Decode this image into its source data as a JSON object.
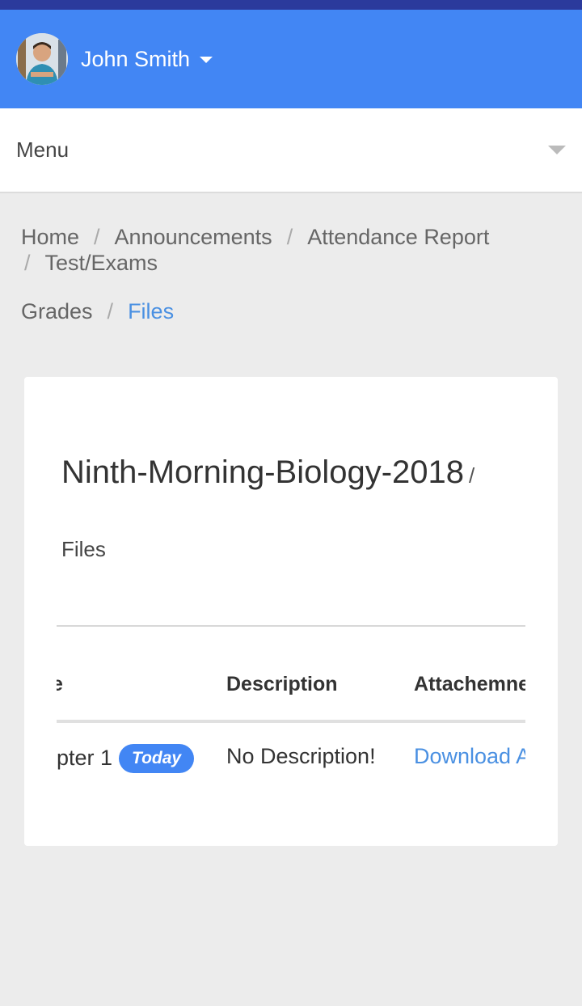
{
  "header": {
    "user_name": "John Smith"
  },
  "menu": {
    "label": "Menu"
  },
  "breadcrumb": {
    "items": [
      "Home",
      "Announcements",
      "Attendance Report",
      "Test/Exams",
      "Grades"
    ],
    "active": "Files",
    "separator": "/"
  },
  "card": {
    "title": "Ninth-Morning-Biology-2018",
    "title_separator": "/",
    "subtitle": "Files",
    "table": {
      "columns": [
        "e",
        "Description",
        "Attachemne"
      ],
      "rows": [
        {
          "name": "pter 1",
          "badge": "Today",
          "description": "No Description!",
          "attachment": "Download A"
        }
      ]
    }
  },
  "colors": {
    "header_bg": "#4286f4",
    "top_strip": "#2b3a9c",
    "link": "#4a90e2",
    "badge_bg": "#4286f4"
  }
}
